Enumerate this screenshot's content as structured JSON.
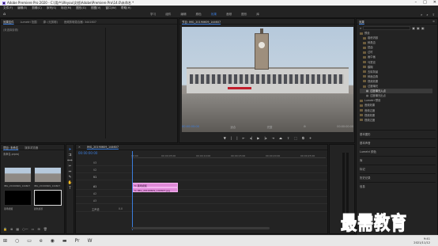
{
  "window": {
    "title": "Adobe Premiere Pro 2020 - C:\\用户\\lifeyou\\文档\\Adobe\\Premiere Pro\\14.0\\未命名 *"
  },
  "menu": [
    "文件(F)",
    "编辑(E)",
    "剪辑(C)",
    "序列(S)",
    "标记(M)",
    "图形(G)",
    "视图(V)",
    "窗口(W)",
    "帮助(H)"
  ],
  "workspaces": {
    "tabs": [
      "学习",
      "组件",
      "编辑",
      "颜色",
      "效果",
      "音频",
      "图形",
      "库"
    ],
    "active": "效果"
  },
  "source_panel": {
    "tabs": [
      "效果控件",
      "Lumetri 范围",
      "源: (无剪辑)",
      "音频剪辑混合器: 3441607"
    ],
    "empty_text": "(未选择剪辑)"
  },
  "program": {
    "tab": "节目: IMG_20190609_144607",
    "timecode_in": "00:00:00:00",
    "fit": "适合",
    "scale": "完整",
    "timecode_out": "00:00:00:00",
    "controls": [
      "标记入点",
      "标记出点",
      "转到入点",
      "后退一帧",
      "播放",
      "前进一帧",
      "转到出点",
      "插入",
      "覆盖",
      "导出帧",
      "比较视图"
    ]
  },
  "effects": {
    "title": "效果",
    "search_placeholder": "",
    "tree": [
      {
        "label": "预设",
        "indent": 1,
        "selected": false
      },
      {
        "label": "卷积内核",
        "indent": 2,
        "selected": false
      },
      {
        "label": "斜角边",
        "indent": 2,
        "selected": false
      },
      {
        "label": "扭曲",
        "indent": 2,
        "selected": false
      },
      {
        "label": "过时",
        "indent": 2,
        "selected": false
      },
      {
        "label": "画中画",
        "indent": 2,
        "selected": false
      },
      {
        "label": "马赛克",
        "indent": 2,
        "selected": false
      },
      {
        "label": "模糊",
        "indent": 2,
        "selected": false
      },
      {
        "label": "去除背景",
        "indent": 2,
        "selected": false
      },
      {
        "label": "斜面边角",
        "indent": 2,
        "selected": false
      },
      {
        "label": "视频效果",
        "indent": 2,
        "selected": false
      },
      {
        "label": "过度曝光",
        "indent": 2,
        "selected": false
      },
      {
        "label": "过度曝光入点",
        "indent": 3,
        "selected": true
      },
      {
        "label": "过度曝光出点",
        "indent": 3,
        "selected": false
      },
      {
        "label": "Lumetri 预设",
        "indent": 1,
        "selected": false
      },
      {
        "label": "音频效果",
        "indent": 1,
        "selected": false
      },
      {
        "label": "音频过渡",
        "indent": 1,
        "selected": false
      },
      {
        "label": "视频效果",
        "indent": 1,
        "selected": false
      },
      {
        "label": "视频过渡",
        "indent": 1,
        "selected": false
      }
    ],
    "sections": [
      "基本图形",
      "基本声音",
      "Lumetri 颜色",
      "库",
      "标记",
      "历史记录",
      "信息"
    ]
  },
  "project": {
    "tabs": [
      "项目: 未命名",
      "媒体浏览器"
    ],
    "filename": "未命名.prproj",
    "items": [
      {
        "name": "IMG_20190609_144607",
        "duration": ""
      },
      {
        "name": "IMG_20190609_144607",
        "duration": "5:00"
      },
      {
        "name": "黑场视频",
        "duration": ""
      },
      {
        "name": "颜色遮罩",
        "duration": ""
      }
    ]
  },
  "timeline": {
    "tab": "IMG_20190609_144607",
    "timecode": "00:00:00:00",
    "ruler": [
      "00:00",
      "00:00:05:00",
      "00:00:10:00",
      "00:00:15:00",
      "00:00:20:00",
      "00:00:25:00"
    ],
    "tracks": [
      "V3",
      "V2",
      "V1",
      "A1",
      "A2",
      "A3",
      "主声道"
    ],
    "clips": [
      {
        "track": "V2",
        "label": "fx 黑场视频"
      },
      {
        "track": "V1",
        "label": "fx IMG_20190609_144607.jpg"
      }
    ],
    "master_value": "0.0"
  },
  "taskbar": {
    "time": "9:41",
    "date": "2021/11/12"
  },
  "watermark": {
    "text": "最需教育"
  }
}
